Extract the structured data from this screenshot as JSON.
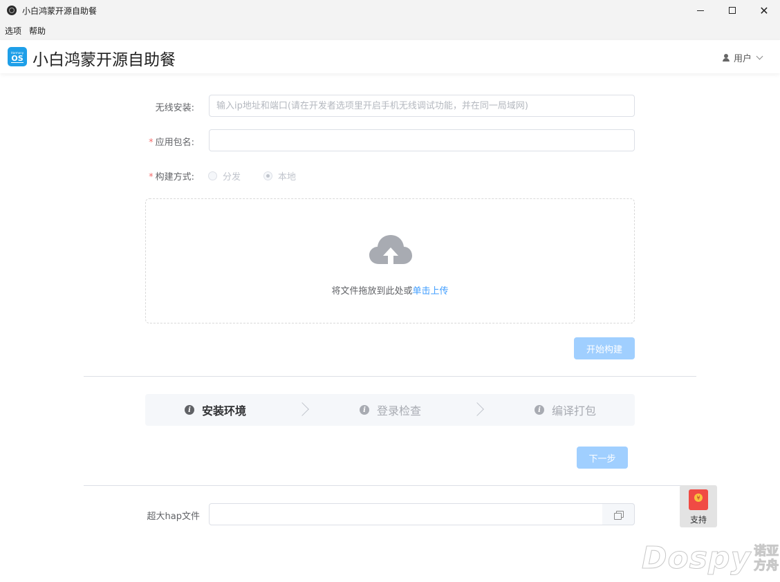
{
  "window": {
    "title": "小白鸿蒙开源自助餐",
    "controls": {
      "minimize": "—",
      "maximize": "☐",
      "close": "✕"
    }
  },
  "menubar": {
    "items": [
      "选项",
      "帮助"
    ]
  },
  "header": {
    "logo_small": "Harmony",
    "logo_os": "OS",
    "brand": "小白鸿蒙开源自助餐",
    "user_label": "用户"
  },
  "form": {
    "wireless_label": "无线安装:",
    "wireless_placeholder": "输入ip地址和端口(请在开发者选项里开启手机无线调试功能，并在同一局域网)",
    "wireless_value": "",
    "package_required": "*",
    "package_label": "应用包名:",
    "package_value": "",
    "build_required": "*",
    "build_label": "构建方式:",
    "build_options": [
      {
        "label": "分发",
        "checked": false
      },
      {
        "label": "本地",
        "checked": true
      }
    ]
  },
  "upload": {
    "text": "将文件拖放到此处或",
    "link": "单击上传"
  },
  "start_build_button": "开始构建",
  "steps": [
    {
      "label": "安装环境",
      "active": true,
      "icon": "i"
    },
    {
      "label": "登录检查",
      "active": false,
      "icon": "i"
    },
    {
      "label": "编译打包",
      "active": false,
      "icon": "i"
    }
  ],
  "next_button": "下一步",
  "large_hap": {
    "label": "超大hap文件",
    "value": ""
  },
  "support": {
    "label": "支持",
    "coin": "¥"
  },
  "watermark": {
    "main": "Dospy",
    "side_top": "诺亚",
    "side_bottom": "方舟"
  },
  "colors": {
    "primary": "#409eff",
    "primary_disabled": "#a0cfff",
    "required": "#f56c6c",
    "logo": "#1e9fe8"
  }
}
